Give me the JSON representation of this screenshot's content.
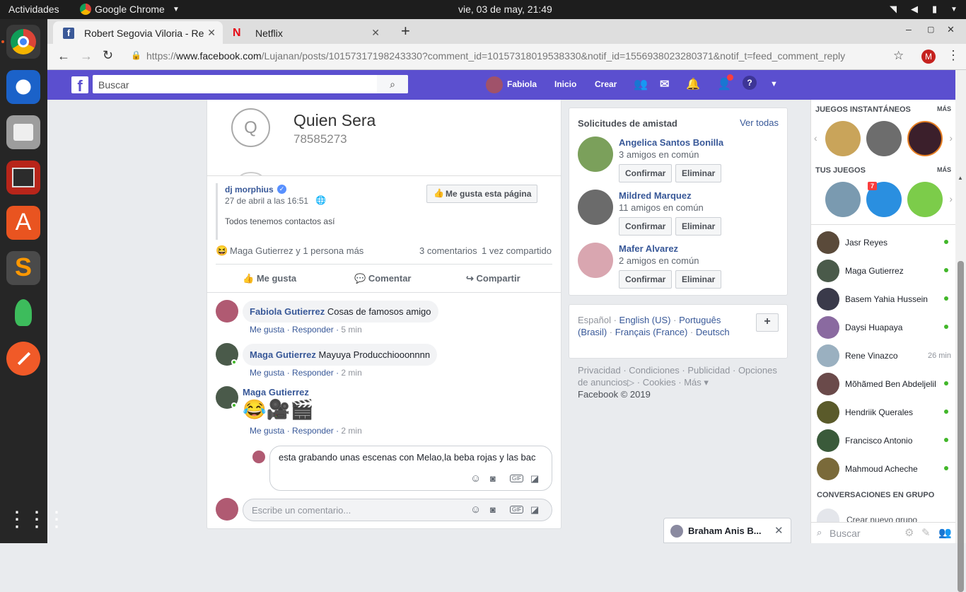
{
  "os": {
    "activities": "Actividades",
    "app": "Google Chrome",
    "clock": "vie, 03 de may, 21:49"
  },
  "browser": {
    "tabs": [
      {
        "title": "Robert Segovia Viloria - Re"
      },
      {
        "title": "Netflix"
      }
    ],
    "url_prefix": "https://",
    "url_domain": "www.facebook.com",
    "url_rest": "/Lujanan/posts/10157317198243330?comment_id=10157318019538330&notif_id=1556938023280371&notif_t=feed_comment_reply",
    "profile_letter": "M"
  },
  "fb": {
    "search_placeholder": "Buscar",
    "user": "Fabiola",
    "nav": [
      "Inicio",
      "Crear"
    ],
    "colors": {
      "brand": "#5b4fcf",
      "link": "#385898",
      "online": "#42b72a"
    }
  },
  "post": {
    "contact_initial": "Q",
    "contact_name": "Quien Sera",
    "contact_number": "78585273",
    "page_name": "dj morphius",
    "date": "27 de abril a las 16:51",
    "like_page": "Me gusta esta página",
    "text": "Todos tenemos contactos así",
    "reactions": "Maga Gutierrez y 1 persona más",
    "comments_count": "3 comentarios",
    "shares": "1 vez compartido",
    "actions": [
      "Me gusta",
      "Comentar",
      "Compartir"
    ]
  },
  "comments": [
    {
      "author": "Fabiola Gutierrez",
      "text": "Cosas de famosos amigo",
      "like": "Me gusta",
      "reply": "Responder",
      "time": "5 min"
    },
    {
      "author": "Maga Gutierrez",
      "text": "Mayuya Producchiooonnnn",
      "like": "Me gusta",
      "reply": "Responder",
      "time": "2 min"
    },
    {
      "author": "Maga Gutierrez",
      "text": "😂🎥🎬",
      "like": "Me gusta",
      "reply": "Responder",
      "time": "2 min"
    }
  ],
  "reply_draft": "esta grabando unas escenas con Melao,la beba rojas y las bac",
  "comment_placeholder": "Escribe un comentario...",
  "friend_requests": {
    "title": "Solicitudes de amistad",
    "see_all": "Ver todas",
    "confirm": "Confirmar",
    "delete": "Eliminar",
    "items": [
      {
        "name": "Angelica Santos Bonilla",
        "mutual": "3 amigos en común"
      },
      {
        "name": "Mildred Marquez",
        "mutual": "11 amigos en común"
      },
      {
        "name": "Mafer Alvarez",
        "mutual": "2 amigos en común"
      }
    ]
  },
  "languages": {
    "current": "Español",
    "items": [
      "English (US)",
      "Português (Brasil)",
      "Français (France)",
      "Deutsch"
    ],
    "add": "+"
  },
  "footer": {
    "links": [
      "Privacidad",
      "Condiciones",
      "Publicidad",
      "Opciones de anuncios",
      "Cookies",
      "Más"
    ],
    "copyright": "Facebook © 2019"
  },
  "sidebar": {
    "instant_games": "JUEGOS INSTANTÁNEOS",
    "your_games": "TUS JUEGOS",
    "more": "MÁS",
    "badge": "7",
    "contacts": [
      {
        "name": "Jasr Reyes",
        "status": "online"
      },
      {
        "name": "Maga Gutierrez",
        "status": "online"
      },
      {
        "name": "Basem Yahia Hussein",
        "status": "online"
      },
      {
        "name": "Daysi Huapaya",
        "status": "online"
      },
      {
        "name": "Rene Vinazco",
        "status": "26 min"
      },
      {
        "name": "Mõhãmed Ben Abdeljelil",
        "status": "online"
      },
      {
        "name": "Hendriik Querales",
        "status": "online"
      },
      {
        "name": "Francisco Antonio",
        "status": "online"
      },
      {
        "name": "Mahmoud Acheche",
        "status": "online"
      }
    ],
    "group_header": "CONVERSACIONES EN GRUPO",
    "new_group": "Crear nuevo grupo",
    "search": "Buscar"
  },
  "chat_tab": {
    "name": "Braham Anis B..."
  }
}
